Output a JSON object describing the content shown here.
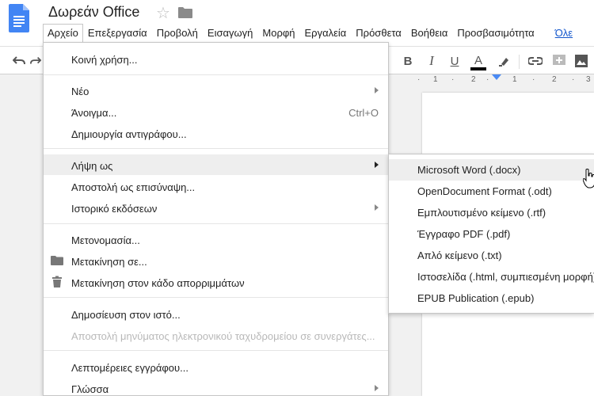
{
  "app": {
    "doc_title": "Δωρεάν Office",
    "brand_color": "#4285f4"
  },
  "menubar": {
    "items": [
      {
        "label": "Αρχείο",
        "active": true
      },
      {
        "label": "Επεξεργασία"
      },
      {
        "label": "Προβολή"
      },
      {
        "label": "Εισαγωγή"
      },
      {
        "label": "Μορφή"
      },
      {
        "label": "Εργαλεία"
      },
      {
        "label": "Πρόσθετα"
      },
      {
        "label": "Βοήθεια"
      },
      {
        "label": "Προσβασιμότητα"
      },
      {
        "label": "Όλε"
      }
    ]
  },
  "toolbar": {
    "bold": "B",
    "italic": "I",
    "underline": "U",
    "text_color": "A",
    "icons": [
      "undo-icon",
      "redo-icon",
      "bold-icon",
      "italic-icon",
      "underline-icon",
      "text-color-icon",
      "highlight-icon",
      "link-icon",
      "comment-icon",
      "image-icon"
    ]
  },
  "ruler": {
    "ticks": [
      "·",
      "1",
      "·",
      "2",
      "·",
      "1",
      "·",
      "2",
      "·",
      "3"
    ]
  },
  "file_menu": {
    "share": "Κοινή χρήση...",
    "new": "Νέο",
    "open": "Άνοιγμα...",
    "open_shortcut": "Ctrl+O",
    "make_copy": "Δημιουργία αντιγράφου...",
    "download_as": "Λήψη ως",
    "email_attachment": "Αποστολή ως επισύναψη...",
    "version_history": "Ιστορικό εκδόσεων",
    "rename": "Μετονομασία...",
    "move_to": "Μετακίνηση σε...",
    "move_to_trash": "Μετακίνηση στον κάδο απορριμμάτων",
    "publish": "Δημοσίευση στον ιστό...",
    "email_collaborators": "Αποστολή μηνύματος ηλεκτρονικού ταχυδρομείου σε συνεργάτες...",
    "details": "Λεπτομέρειες εγγράφου...",
    "language": "Γλώσσα"
  },
  "download_submenu": {
    "items": [
      "Microsoft Word (.docx)",
      "OpenDocument Format (.odt)",
      "Εμπλουτισμένο κείμενο (.rtf)",
      "Έγγραφο PDF (.pdf)",
      "Απλό κείμενο (.txt)",
      "Ιστοσελίδα (.html, συμπιεσμένη μορφή)",
      "EPUB Publication (.epub)"
    ]
  }
}
